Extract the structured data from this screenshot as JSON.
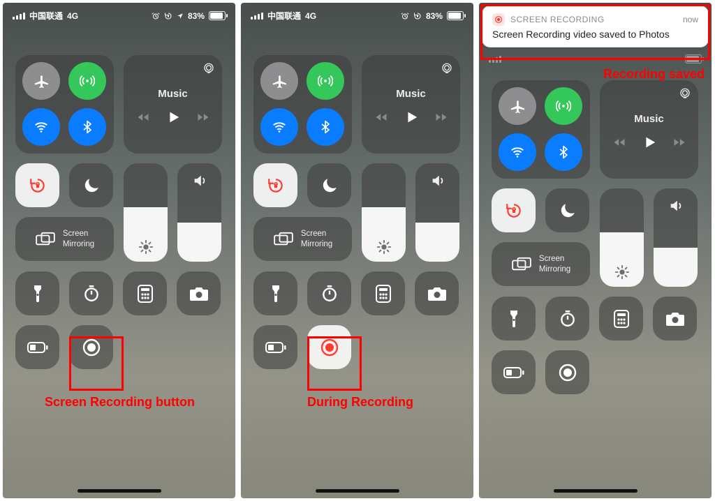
{
  "status": {
    "carrier": "中国联通",
    "network": "4G",
    "batteryPct": "83%",
    "batteryFill": 83
  },
  "music_label": "Music",
  "mirror_label": "Screen\nMirroring",
  "notification": {
    "app": "SCREEN RECORDING",
    "time": "now",
    "message": "Screen Recording video saved to Photos"
  },
  "captions": {
    "screen1": "Screen Recording button",
    "screen2": "During Recording",
    "screen3": "Recording saved"
  },
  "icons": {
    "alarm": "⏰",
    "lock": "🔒",
    "location": "➤"
  }
}
